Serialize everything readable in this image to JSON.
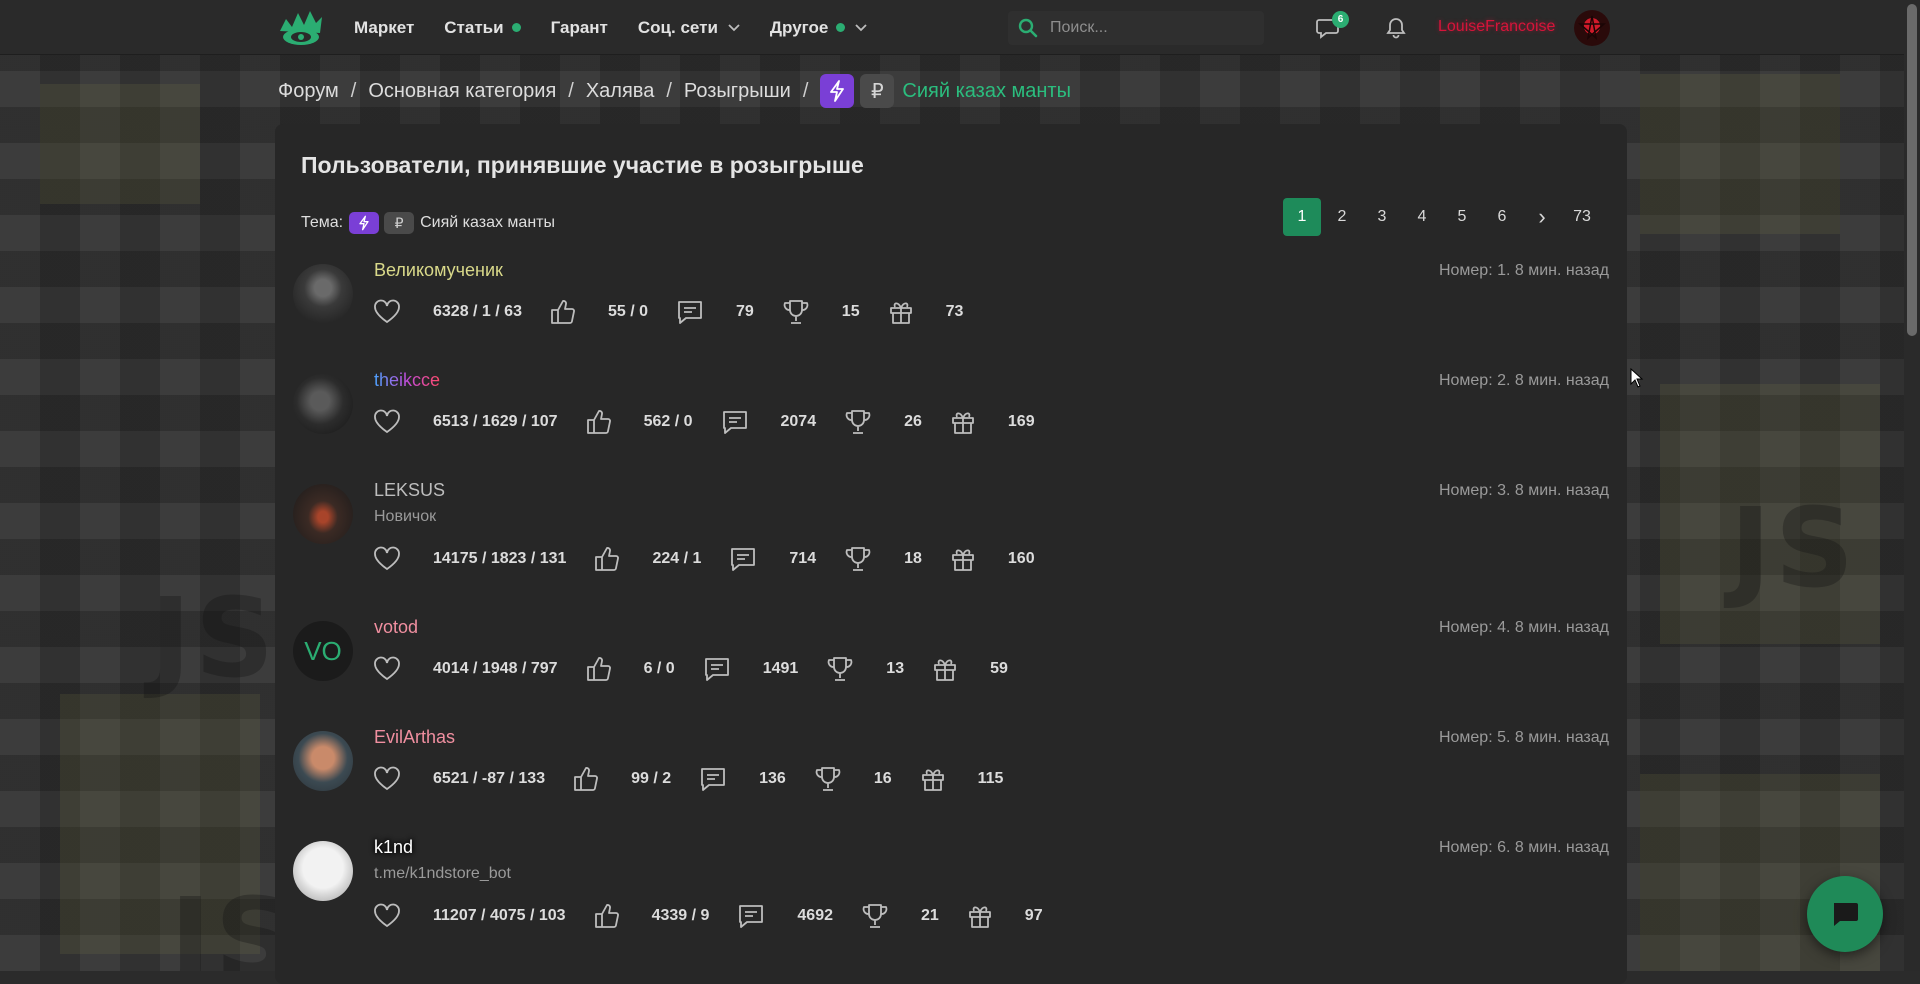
{
  "nav": {
    "items": [
      {
        "label": "Маркет",
        "dot": false,
        "dropdown": false
      },
      {
        "label": "Статьи",
        "dot": true,
        "dropdown": false
      },
      {
        "label": "Гарант",
        "dot": false,
        "dropdown": false
      },
      {
        "label": "Соц. сети",
        "dot": false,
        "dropdown": true
      },
      {
        "label": "Другое",
        "dot": true,
        "dropdown": true
      }
    ],
    "search_placeholder": "Поиск...",
    "conversations_badge": "6",
    "username": "LouiseFrancoise"
  },
  "breadcrumb": {
    "items": [
      "Форум",
      "Основная категория",
      "Халява",
      "Розыгрыши"
    ],
    "current": "Сияй казах манты",
    "rub_symbol": "₽"
  },
  "panel": {
    "title": "Пользователи, принявшие участие в розыгрыше",
    "theme_label": "Тема:",
    "theme_name": "Сияй казах манты"
  },
  "pagination": {
    "pages": [
      "1",
      "2",
      "3",
      "4",
      "5",
      "6"
    ],
    "active": "1",
    "next": "›",
    "last": "73"
  },
  "users": [
    {
      "name": "Великомученик",
      "name_color": "#d9d98a",
      "subtitle": "",
      "meta": "Номер: 1. 8 мин. назад",
      "likes": "6328 / 1 / 63",
      "thumbs": "55 / 0",
      "messages": "79",
      "trophies": "15",
      "gifts": "73"
    },
    {
      "name": "theikсce",
      "name_color": "gradient",
      "subtitle": "",
      "meta": "Номер: 2. 8 мин. назад",
      "likes": "6513 / 1629 / 107",
      "thumbs": "562 / 0",
      "messages": "2074",
      "trophies": "26",
      "gifts": "169"
    },
    {
      "name": "LEKSUS",
      "name_color": "#bdbdbd",
      "subtitle": "Новичок",
      "meta": "Номер: 3. 8 мин. назад",
      "likes": "14175 / 1823 / 131",
      "thumbs": "224 / 1",
      "messages": "714",
      "trophies": "18",
      "gifts": "160"
    },
    {
      "name": "votod",
      "name_color": "#f08fa0",
      "subtitle": "",
      "meta": "Номер: 4. 8 мин. назад",
      "avatar_text": "VO",
      "likes": "4014 / 1948 / 797",
      "thumbs": "6 / 0",
      "messages": "1491",
      "trophies": "13",
      "gifts": "59"
    },
    {
      "name": "EvilArthas",
      "name_color": "#f08fa0",
      "subtitle": "",
      "meta": "Номер: 5. 8 мин. назад",
      "likes": "6521 / -87 / 133",
      "thumbs": "99 / 2",
      "messages": "136",
      "trophies": "16",
      "gifts": "115"
    },
    {
      "name": "k1nd",
      "name_color": "#ffffff",
      "subtitle": "t.me/k1ndstore_bot",
      "meta": "Номер: 6. 8 мин. назад",
      "likes": "11207 / 4075 / 103",
      "thumbs": "4339 / 9",
      "messages": "4692",
      "trophies": "21",
      "gifts": "97"
    }
  ],
  "colors": {
    "accent": "#2bad72",
    "bolt_tag": "#7a3fd6",
    "username_red": "#d6143a"
  }
}
